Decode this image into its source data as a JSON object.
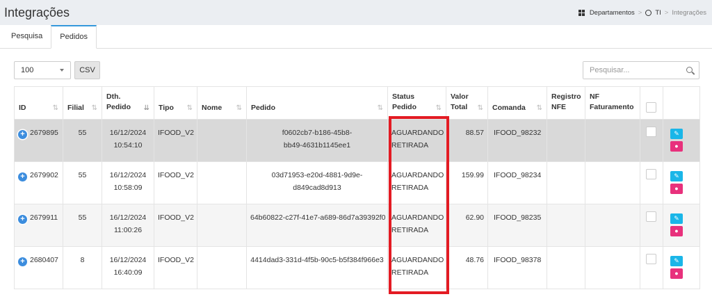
{
  "header": {
    "title": "Integrações"
  },
  "breadcrumb": {
    "item1": "Departamentos",
    "item2": "TI",
    "item3": "Integrações",
    "sep": ">"
  },
  "tabs": {
    "pesquisa": "Pesquisa",
    "pedidos": "Pedidos"
  },
  "toolbar": {
    "page_size": "100",
    "csv_label": "CSV",
    "search_placeholder": "Pesquisar..."
  },
  "table": {
    "headers": {
      "id": "ID",
      "filial": "Filial",
      "dth1": "Dth.",
      "dth2": "Pedido",
      "tipo": "Tipo",
      "nome": "Nome",
      "pedido": "Pedido",
      "status1": "Status",
      "status2": "Pedido",
      "valor1": "Valor",
      "valor2": "Total",
      "comanda": "Comanda",
      "registro1": "Registro",
      "registro2": "NFE",
      "nf1": "NF",
      "nf2": "Faturamento"
    },
    "rows": [
      {
        "id": "2679895",
        "filial": "55",
        "date": "16/12/2024",
        "time": "10:54:10",
        "tipo": "IFOOD_V2",
        "nome": "",
        "pedido1": "f0602cb7-b186-45b8-",
        "pedido2": "bb49-4631b1145ee1",
        "status1": "AGUARDANDO",
        "status2": "RETIRADA",
        "valor": "88.57",
        "comanda": "IFOOD_98232"
      },
      {
        "id": "2679902",
        "filial": "55",
        "date": "16/12/2024",
        "time": "10:58:09",
        "tipo": "IFOOD_V2",
        "nome": "",
        "pedido1": "03d71953-e20d-4881-9d9e-",
        "pedido2": "d849cad8d913",
        "status1": "AGUARDANDO",
        "status2": "RETIRADA",
        "valor": "159.99",
        "comanda": "IFOOD_98234"
      },
      {
        "id": "2679911",
        "filial": "55",
        "date": "16/12/2024",
        "time": "11:00:26",
        "tipo": "IFOOD_V2",
        "nome": "",
        "pedido1": "64b60822-c27f-41e7-a689-86d7a39392f0",
        "pedido2": "",
        "status1": "AGUARDANDO",
        "status2": "RETIRADA",
        "valor": "62.90",
        "comanda": "IFOOD_98235"
      },
      {
        "id": "2680407",
        "filial": "8",
        "date": "16/12/2024",
        "time": "16:40:09",
        "tipo": "IFOOD_V2",
        "nome": "",
        "pedido1": "4414dad3-331d-4f5b-90c5-b5f384f966e3",
        "pedido2": "",
        "status1": "AGUARDANDO",
        "status2": "RETIRADA",
        "valor": "48.76",
        "comanda": "IFOOD_98378"
      }
    ]
  },
  "colors": {
    "accent": "#3498db",
    "highlight": "#e31b23",
    "edit": "#1ab6e8",
    "chat": "#e8317c"
  }
}
